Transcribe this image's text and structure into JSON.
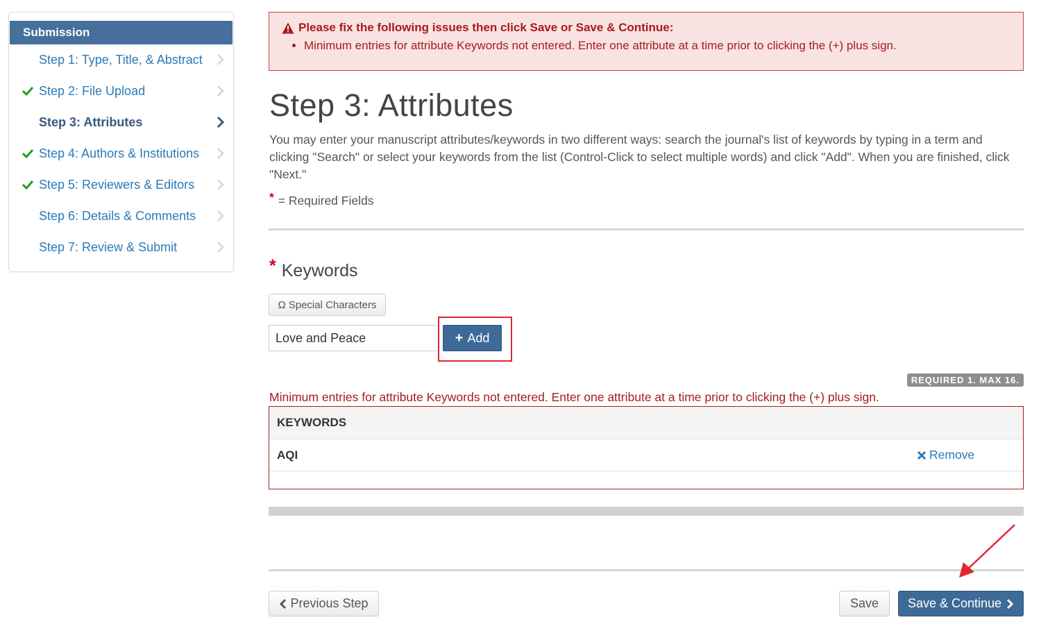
{
  "colors": {
    "primary": "#3d6a96",
    "sidebar_header": "#46709b",
    "link": "#2a7ab8",
    "error": "#a61c1c",
    "success": "#1aa01a",
    "annotation_red": "#e0262f"
  },
  "sidebar": {
    "header": "Submission",
    "items": [
      {
        "label": "Step 1: Type, Title, & Abstract",
        "checked": false,
        "active": false
      },
      {
        "label": "Step 2: File Upload",
        "checked": true,
        "active": false
      },
      {
        "label": "Step 3: Attributes",
        "checked": false,
        "active": true
      },
      {
        "label": "Step 4: Authors & Institutions",
        "checked": true,
        "active": false
      },
      {
        "label": "Step 5: Reviewers & Editors",
        "checked": true,
        "active": false
      },
      {
        "label": "Step 6: Details & Comments",
        "checked": false,
        "active": false
      },
      {
        "label": "Step 7: Review & Submit",
        "checked": false,
        "active": false
      }
    ]
  },
  "alert": {
    "title": "Please fix the following issues then click Save or Save & Continue:",
    "messages": [
      "Minimum entries for attribute Keywords not entered. Enter one attribute at a time prior to clicking the (+) plus sign."
    ]
  },
  "page": {
    "title": "Step 3: Attributes",
    "intro": "You may enter your manuscript attributes/keywords in two different ways: search the journal's list of keywords by typing in a term and clicking \"Search\" or select your keywords from the list (Control-Click to select multiple words) and click \"Add\". When you are finished, click \"Next.\"",
    "required_star": "*",
    "required_text": "= Required Fields"
  },
  "keywords": {
    "title": "Keywords",
    "special_chars_label": "Special Characters",
    "special_chars_icon": "Ω",
    "input_value": "Love and Peace",
    "add_label": "Add",
    "add_icon": "+",
    "badge": "REQUIRED 1. MAX 16.",
    "error": "Minimum entries for attribute Keywords not entered. Enter one attribute at a time prior to clicking the (+) plus sign.",
    "table_header": "KEYWORDS",
    "rows": [
      {
        "keyword": "AQI",
        "remove_label": "Remove"
      }
    ]
  },
  "footer": {
    "previous_label": "Previous Step",
    "save_label": "Save",
    "save_continue_label": "Save & Continue"
  }
}
